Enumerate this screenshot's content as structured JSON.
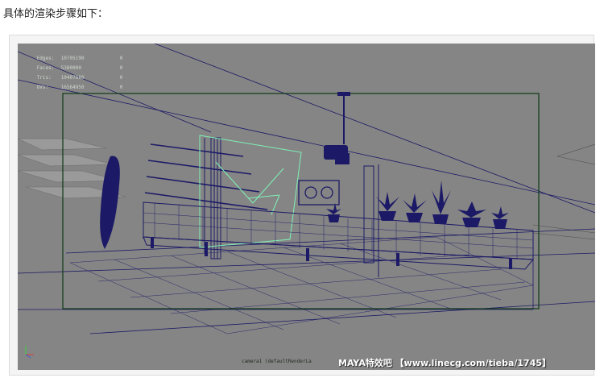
{
  "page": {
    "intro_text": "具体的渲染步骤如下："
  },
  "viewport": {
    "hud": [
      {
        "label": "Edges:",
        "value1": "10705190",
        "value2": "0"
      },
      {
        "label": "Faces:",
        "value1": "5380000",
        "value2": "0"
      },
      {
        "label": "Tris:",
        "value1": "10407680",
        "value2": "0"
      },
      {
        "label": "UVs:",
        "value1": "16564950",
        "value2": "0"
      }
    ],
    "camera_label": "camera1 (defaultRenderLa",
    "watermark": "MAYA特效吧 【www.linecg.com/tieba/1745】",
    "colors": {
      "background": "#858585",
      "wireframe": "#1c1a66",
      "selection": "#7ff2b8",
      "resolution_gate": "#0d3a14"
    }
  }
}
